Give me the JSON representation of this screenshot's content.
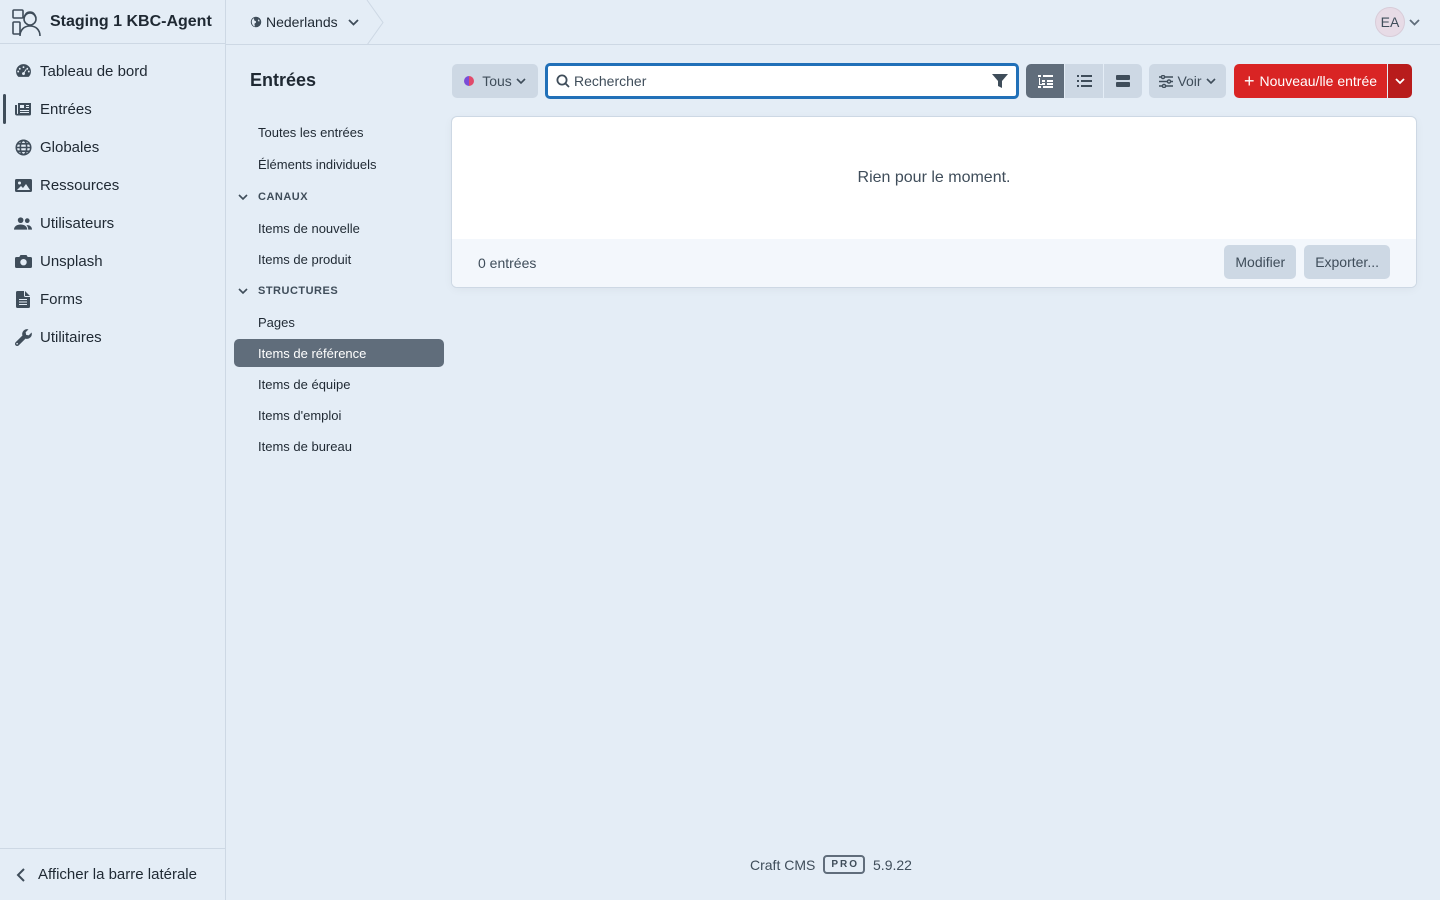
{
  "site": {
    "name": "Staging 1 KBC-Agent"
  },
  "global_nav": [
    {
      "label": "Tableau de bord",
      "icon": "gauge-icon"
    },
    {
      "label": "Entrées",
      "icon": "newspaper-icon",
      "active": true
    },
    {
      "label": "Globales",
      "icon": "globe-icon"
    },
    {
      "label": "Ressources",
      "icon": "image-icon"
    },
    {
      "label": "Utilisateurs",
      "icon": "users-icon"
    },
    {
      "label": "Unsplash",
      "icon": "camera-icon"
    },
    {
      "label": "Forms",
      "icon": "file-lines-icon"
    },
    {
      "label": "Utilitaires",
      "icon": "wrench-icon"
    }
  ],
  "sidebar_footer": {
    "label": "Afficher la barre latérale"
  },
  "topbar": {
    "site_switcher": "Nederlands",
    "avatar_initials": "EA"
  },
  "page": {
    "title": "Entrées"
  },
  "sources": {
    "top": [
      "Toutes les entrées",
      "Éléments individuels"
    ],
    "channels_heading": "CANAUX",
    "channels": [
      "Items de nouvelle",
      "Items de produit"
    ],
    "structures_heading": "STRUCTURES",
    "structures": [
      "Pages",
      "Items de référence",
      "Items de équipe",
      "Items d'emploi",
      "Items de bureau"
    ],
    "selected": "Items de référence"
  },
  "toolbar": {
    "status_label": "Tous",
    "search_placeholder": "Rechercher",
    "view_label": "Voir",
    "new_label": "Nouveau/lle entrée"
  },
  "content": {
    "empty_message": "Rien pour le moment.",
    "count_label": "0 entrées",
    "modify_label": "Modifier",
    "export_label": "Exporter..."
  },
  "app_info": {
    "name": "Craft CMS",
    "edition": "PRO",
    "version": "5.9.22"
  },
  "colors": {
    "background": "#e4edf6",
    "accent_red": "#d92424",
    "focus_blue": "#2170b8",
    "selected_gray": "#606d7b"
  }
}
